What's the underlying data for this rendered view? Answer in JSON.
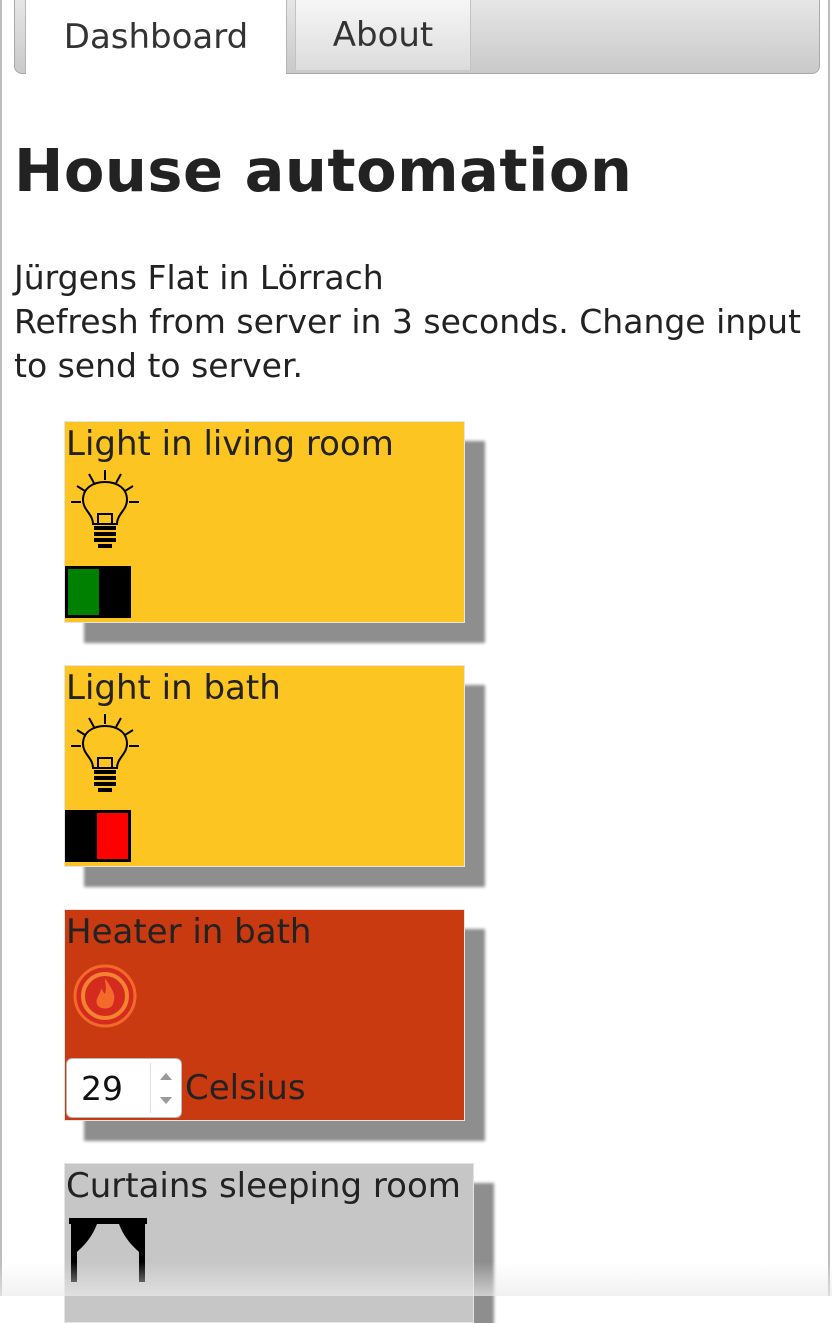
{
  "tabs": [
    {
      "label": "Dashboard",
      "active": true
    },
    {
      "label": "About",
      "active": false
    }
  ],
  "heading": "House automation",
  "intro": {
    "location": "Jürgens Flat in Lörrach",
    "refresh_note": "Refresh from server in 3 seconds. Change input to send to server."
  },
  "devices": [
    {
      "title": "Light in living room",
      "icon": "light-bulb-icon",
      "state": "on",
      "color": "#fdc521",
      "switch_on_color": "#008000"
    },
    {
      "title": "Light in bath",
      "icon": "light-bulb-icon",
      "state": "off",
      "color": "#fdc521",
      "switch_off_color": "#ff0000"
    },
    {
      "title": "Heater in bath",
      "icon": "heater-flame-icon",
      "temperature": "29",
      "unit": "Celsius",
      "color": "#c93a10"
    },
    {
      "title": "Curtains sleeping room",
      "icon": "curtains-icon",
      "color": "#c6c6c6"
    }
  ]
}
